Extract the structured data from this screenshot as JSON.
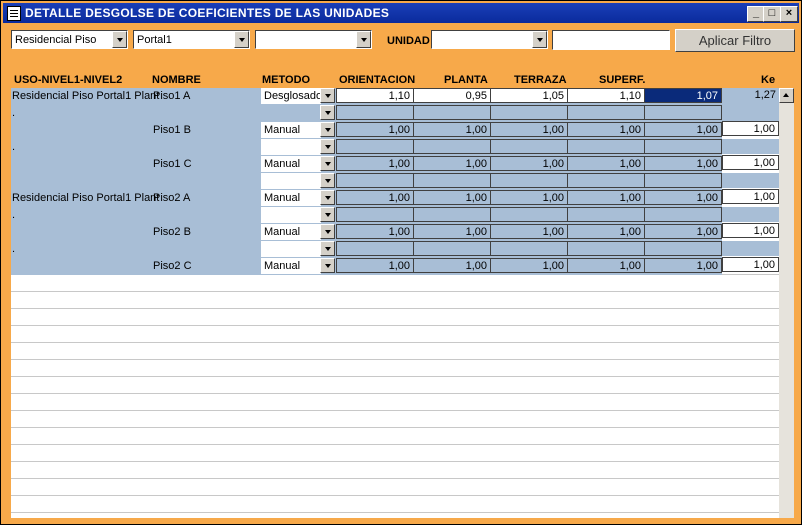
{
  "window": {
    "title": "DETALLE DESGOLSE DE COEFICIENTES DE LAS UNIDADES",
    "minimize": "_",
    "maximize": "□",
    "close": "×"
  },
  "filters": {
    "combo1": "Residencial Piso",
    "combo2": "Portal1",
    "combo3": "",
    "unidad_label": "UNIDAD",
    "combo4": "",
    "text": "",
    "apply_button": "Aplicar Filtro"
  },
  "headers": {
    "uso": "USO-NIVEL1-NIVEL2",
    "nombre": "NOMBRE",
    "metodo": "METODO",
    "orientacion": "ORIENTACION",
    "planta": "PLANTA",
    "terraza": "TERRAZA",
    "superf": "SUPERF.",
    "ke": "Ke"
  },
  "rows": [
    {
      "uso": "Residencial Piso Portal1 Plant",
      "nombre": "Piso1 A",
      "metodo": "Desglosado",
      "orientacion": "1,10",
      "planta": "0,95",
      "terraza": "1,05",
      "superf": "1,10",
      "extra": "1,07",
      "ke": "1,27"
    },
    {
      "uso": ".",
      "nombre": "Piso1 B",
      "metodo": "Manual",
      "orientacion": "1,00",
      "planta": "1,00",
      "terraza": "1,00",
      "superf": "1,00",
      "extra": "1,00",
      "ke": "1,00"
    },
    {
      "uso": ".",
      "nombre": "Piso1 C",
      "metodo": "Manual",
      "orientacion": "1,00",
      "planta": "1,00",
      "terraza": "1,00",
      "superf": "1,00",
      "extra": "1,00",
      "ke": "1,00"
    },
    {
      "uso": "Residencial Piso Portal1 Plant",
      "nombre": "Piso2 A",
      "metodo": "Manual",
      "orientacion": "1,00",
      "planta": "1,00",
      "terraza": "1,00",
      "superf": "1,00",
      "extra": "1,00",
      "ke": "1,00"
    },
    {
      "uso": ".",
      "nombre": "Piso2 B",
      "metodo": "Manual",
      "orientacion": "1,00",
      "planta": "1,00",
      "terraza": "1,00",
      "superf": "1,00",
      "extra": "1,00",
      "ke": "1,00"
    },
    {
      "uso": ".",
      "nombre": "Piso2 C",
      "metodo": "Manual",
      "orientacion": "1,00",
      "planta": "1,00",
      "terraza": "1,00",
      "superf": "1,00",
      "extra": "1,00",
      "ke": "1,00"
    }
  ],
  "colors": {
    "background": "#f7a94a",
    "row_highlight": "#a8bed6",
    "selected_cell": "#0a2a7a",
    "titlebar": "#0a2a9c"
  }
}
